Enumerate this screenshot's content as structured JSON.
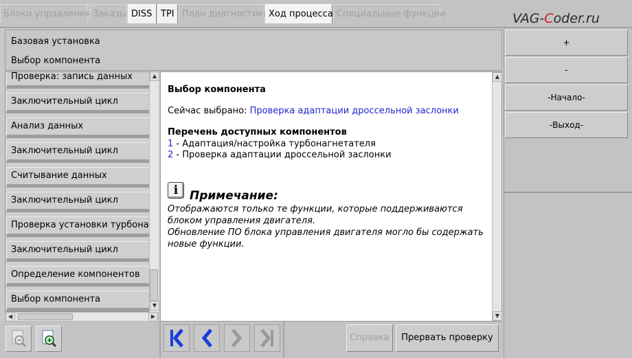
{
  "tabs": [
    {
      "label": "Блоки управления",
      "state": "disabled"
    },
    {
      "label": "Заказы",
      "state": "disabled"
    },
    {
      "label": "DISS",
      "state": "enabled"
    },
    {
      "label": "TPI",
      "state": "enabled"
    },
    {
      "label": "План диагностики",
      "state": "disabled"
    },
    {
      "label": "Ход процесса",
      "state": "active"
    },
    {
      "label": "Специальные функции",
      "state": "disabled"
    }
  ],
  "logo": {
    "part1": "VAG-",
    "part2": "C",
    "part3": "oder.ru",
    "accent_color": "#d21b1b"
  },
  "header": {
    "line1": "Базовая установка",
    "line2": "Выбор компонента"
  },
  "steps": [
    "Проверка: запись данных",
    "Заключительный цикл",
    "Анализ данных",
    "Заключительный цикл",
    "Считывание данных",
    "Заключительный цикл",
    "Проверка установки турбонагнетателя",
    "Заключительный цикл",
    "Определение компонентов",
    "Выбор компонента"
  ],
  "content": {
    "title": "Выбор компонента",
    "current_label": "Сейчас выбрано:",
    "current_value": "Проверка адаптации дроссельной заслонки",
    "list_title": "Перечень доступных компонентов",
    "items": [
      {
        "num": "1",
        "text": " - Адаптация/настройка турбонагнетателя"
      },
      {
        "num": "2",
        "text": " - Проверка адаптации дроссельной заслонки"
      }
    ],
    "note_icon": "info-icon",
    "note_icon_glyph": "i",
    "note_title": "Примечание:",
    "note_lines": [
      "Отображаются только те функции, которые поддерживаются",
      "блоком управления двигателя.",
      "Обновление ПО блока управления двигателя могло бы содержать",
      "новые функции."
    ]
  },
  "right_buttons": [
    "+",
    "-",
    "-Начало-",
    "-Выход-"
  ],
  "bottom": {
    "zoom_out_icon": "zoom-out-icon",
    "zoom_in_icon": "zoom-in-icon",
    "nav_icons": [
      "first-icon",
      "back-icon",
      "forward-icon",
      "last-icon"
    ],
    "help_label": "Справка",
    "abort_label": "Прервать проверку"
  },
  "colors": {
    "link_blue": "#2323c8",
    "nav_blue": "#1a3fd8",
    "nav_disabled": "#9a9a9a"
  }
}
